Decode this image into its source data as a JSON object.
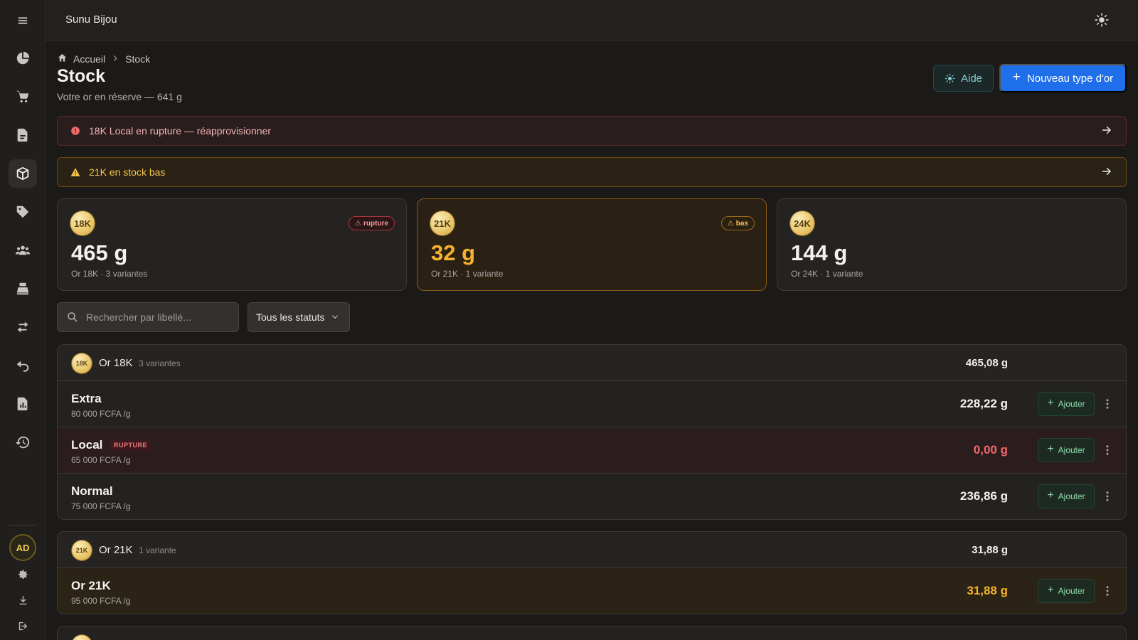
{
  "app": {
    "title": "Sunu Bijou"
  },
  "user": {
    "initials": "AD"
  },
  "breadcrumb": {
    "home": "Accueil",
    "current": "Stock"
  },
  "header": {
    "title": "Stock",
    "subtitle": "Votre or en réserve — 641 g",
    "help_label": "Aide",
    "new_label": "Nouveau type d'or"
  },
  "alerts": [
    {
      "text": "18K Local en rupture — réapprovisionner",
      "level": "danger"
    },
    {
      "text": "21K en stock bas",
      "level": "warning"
    }
  ],
  "cards": [
    {
      "coin": "18K",
      "value": "465 g",
      "sub": "Or 18K · 3 variantes",
      "badge": "rupture",
      "status": "danger"
    },
    {
      "coin": "21K",
      "value": "32 g",
      "sub": "Or 21K · 1 variante",
      "badge": "bas",
      "status": "warning"
    },
    {
      "coin": "24K",
      "value": "144 g",
      "sub": "Or 24K · 1 variante",
      "badge": "",
      "status": "normal"
    }
  ],
  "filters": {
    "search_placeholder": "Rechercher par libellé...",
    "status_selected": "Tous les statuts"
  },
  "groups": [
    {
      "coin": "18K",
      "name": "Or 18K",
      "count": "3 variantes",
      "total": "465,08 g",
      "rows": [
        {
          "name": "Extra",
          "price": "80 000 FCFA /g",
          "qty": "228,22 g",
          "tag": "",
          "status": "normal"
        },
        {
          "name": "Local",
          "price": "65 000 FCFA /g",
          "qty": "0,00 g",
          "tag": "RUPTURE",
          "status": "danger"
        },
        {
          "name": "Normal",
          "price": "75 000 FCFA /g",
          "qty": "236,86 g",
          "tag": "",
          "status": "normal"
        }
      ]
    },
    {
      "coin": "21K",
      "name": "Or 21K",
      "count": "1 variante",
      "total": "31,88 g",
      "rows": [
        {
          "name": "Or 21K",
          "price": "95 000 FCFA /g",
          "qty": "31,88 g",
          "tag": "",
          "status": "warning"
        }
      ]
    }
  ],
  "labels": {
    "add": "Ajouter"
  },
  "icons": {
    "sidebar": [
      "menu-icon",
      "dashboard-pie-icon",
      "cart-icon",
      "document-icon",
      "box-icon",
      "tag-icon",
      "users-icon",
      "cash-register-icon",
      "transfer-icon",
      "return-icon",
      "report-icon",
      "history-icon"
    ],
    "bottom": [
      "settings-icon",
      "download-icon",
      "logout-icon"
    ]
  },
  "colors": {
    "accent": "#1f6feb",
    "danger": "#f06a6a",
    "warning": "#f6b22c",
    "success": "#8fdcaa"
  }
}
